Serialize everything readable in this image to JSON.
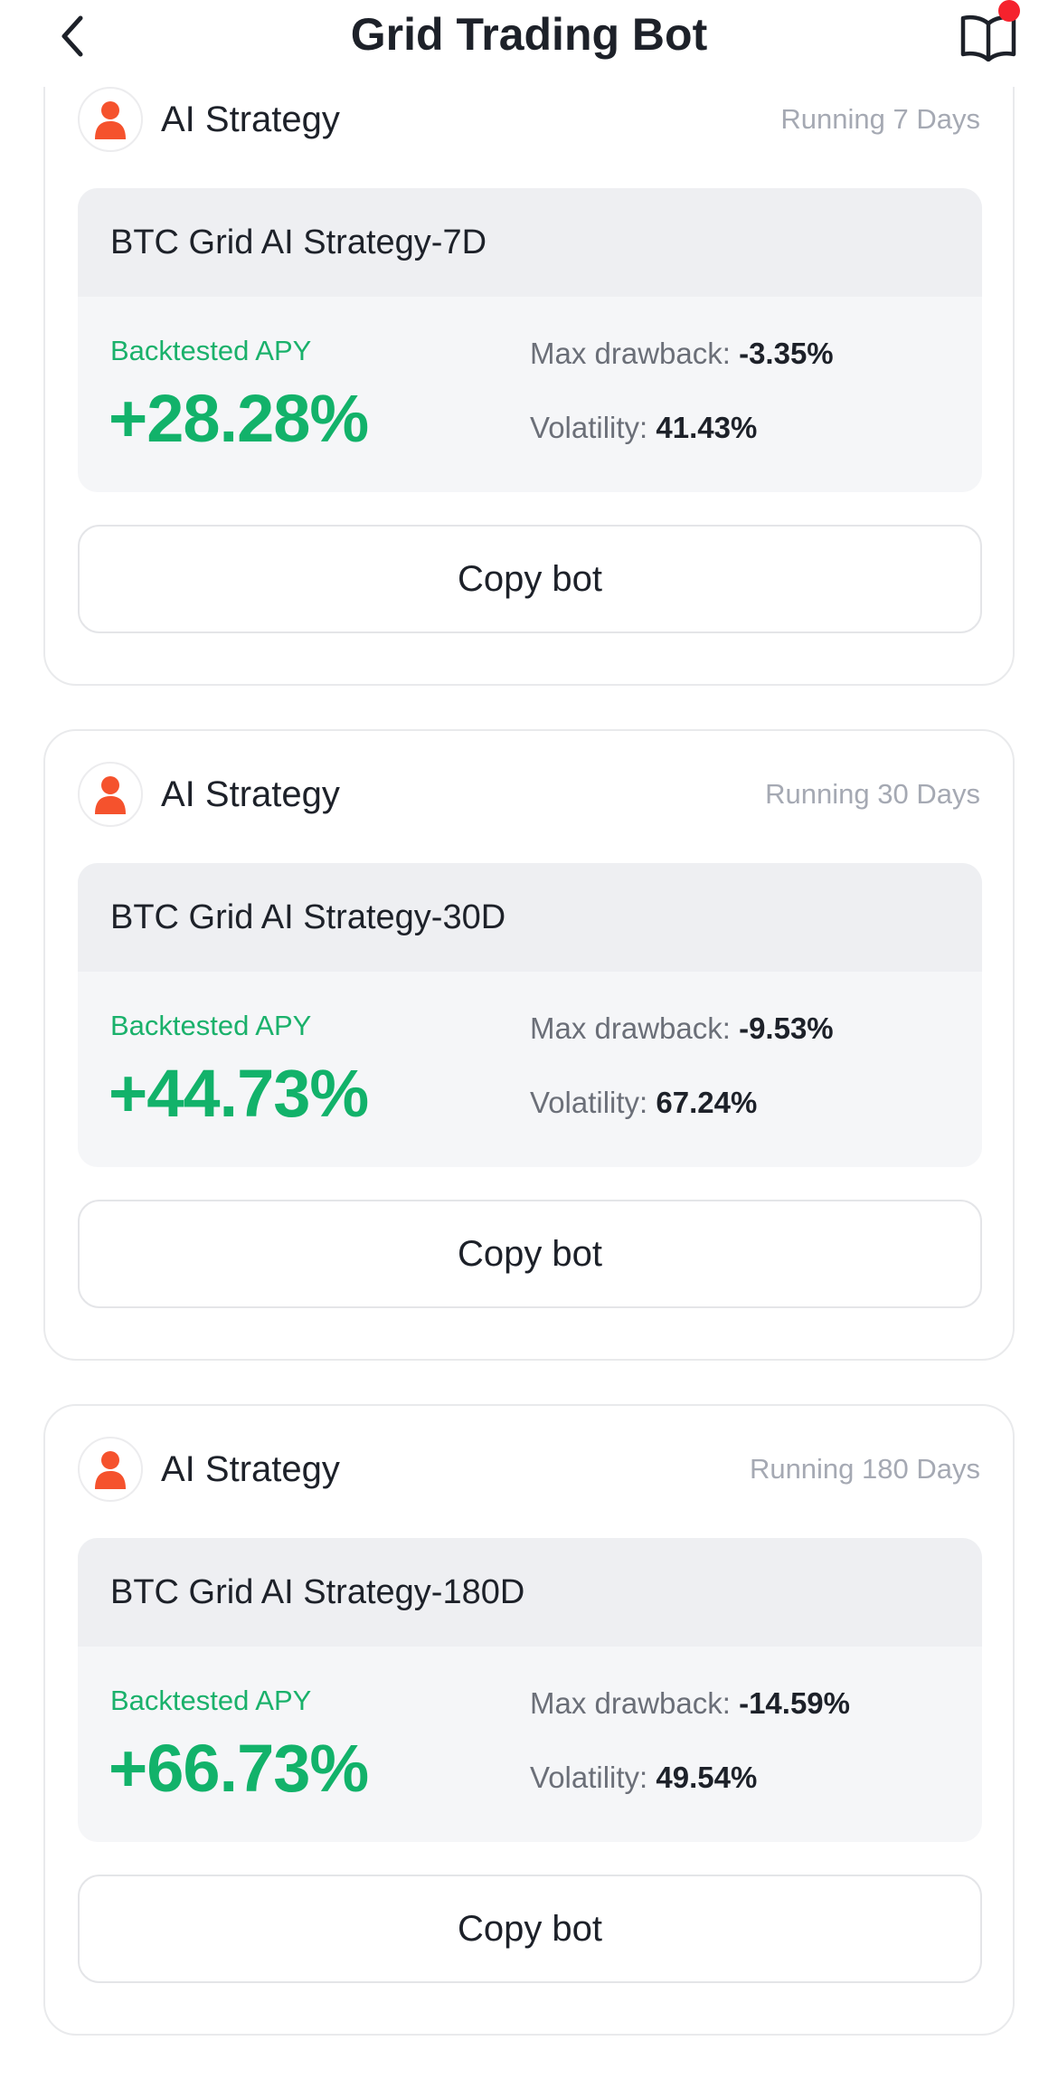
{
  "header": {
    "title": "Grid Trading Bot",
    "back_icon": "chevron-left-icon",
    "guide_icon": "book-icon",
    "notification_color": "#f5222d"
  },
  "colors": {
    "positive": "#12b26a",
    "avatar": "#f5522d"
  },
  "strategies": [
    {
      "label": "AI Strategy",
      "running": "Running 7 Days",
      "name": "BTC Grid AI Strategy-7D",
      "apy_label": "Backtested APY",
      "apy": "+28.28%",
      "drawback_label": "Max drawback:",
      "drawback": "-3.35%",
      "volatility_label": "Volatility:",
      "volatility": "41.43%",
      "button": "Copy bot"
    },
    {
      "label": "AI Strategy",
      "running": "Running 30 Days",
      "name": "BTC Grid AI Strategy-30D",
      "apy_label": "Backtested APY",
      "apy": "+44.73%",
      "drawback_label": "Max drawback:",
      "drawback": "-9.53%",
      "volatility_label": "Volatility:",
      "volatility": "67.24%",
      "button": "Copy bot"
    },
    {
      "label": "AI Strategy",
      "running": "Running 180 Days",
      "name": "BTC Grid AI Strategy-180D",
      "apy_label": "Backtested APY",
      "apy": "+66.73%",
      "drawback_label": "Max drawback:",
      "drawback": "-14.59%",
      "volatility_label": "Volatility:",
      "volatility": "49.54%",
      "button": "Copy bot"
    }
  ]
}
